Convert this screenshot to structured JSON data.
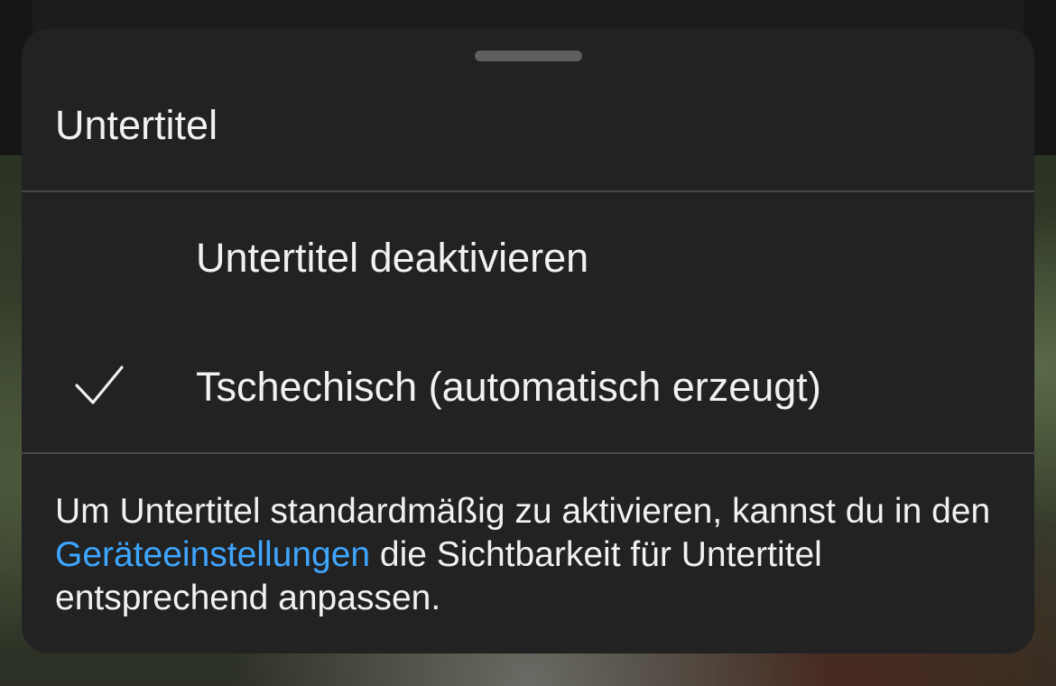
{
  "sheet": {
    "title": "Untertitel",
    "options": [
      {
        "label": "Untertitel deaktivieren",
        "selected": false
      },
      {
        "label": "Tschechisch (automatisch erzeugt)",
        "selected": true
      }
    ],
    "footer": {
      "prefix": "Um Untertitel standardmäßig zu aktivieren, kannst du in den ",
      "link": "Geräteeinstellungen",
      "suffix": " die Sichtbarkeit für Untertitel entsprechend anpassen."
    }
  },
  "icons": {
    "selected_marker": "checkmark-icon",
    "sheet_handle": "drag-handle"
  },
  "colors": {
    "sheet_background": "#222222",
    "text": "#f1f1f1",
    "link": "#3ea6ff",
    "divider": "#464646",
    "handle": "#5e5e5e"
  }
}
